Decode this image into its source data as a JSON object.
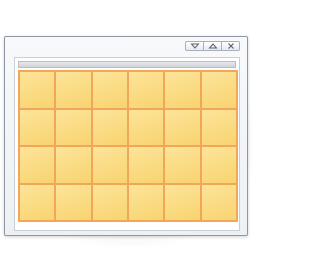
{
  "window": {
    "controls": [
      {
        "name": "minimize",
        "icon": "chevron-down-icon"
      },
      {
        "name": "maximize",
        "icon": "triangle-up-icon"
      },
      {
        "name": "close",
        "icon": "close-icon"
      }
    ]
  },
  "grid": {
    "rows": 4,
    "columns": 6,
    "cell_color": "#f8d46f",
    "line_color": "#f2a65a"
  }
}
